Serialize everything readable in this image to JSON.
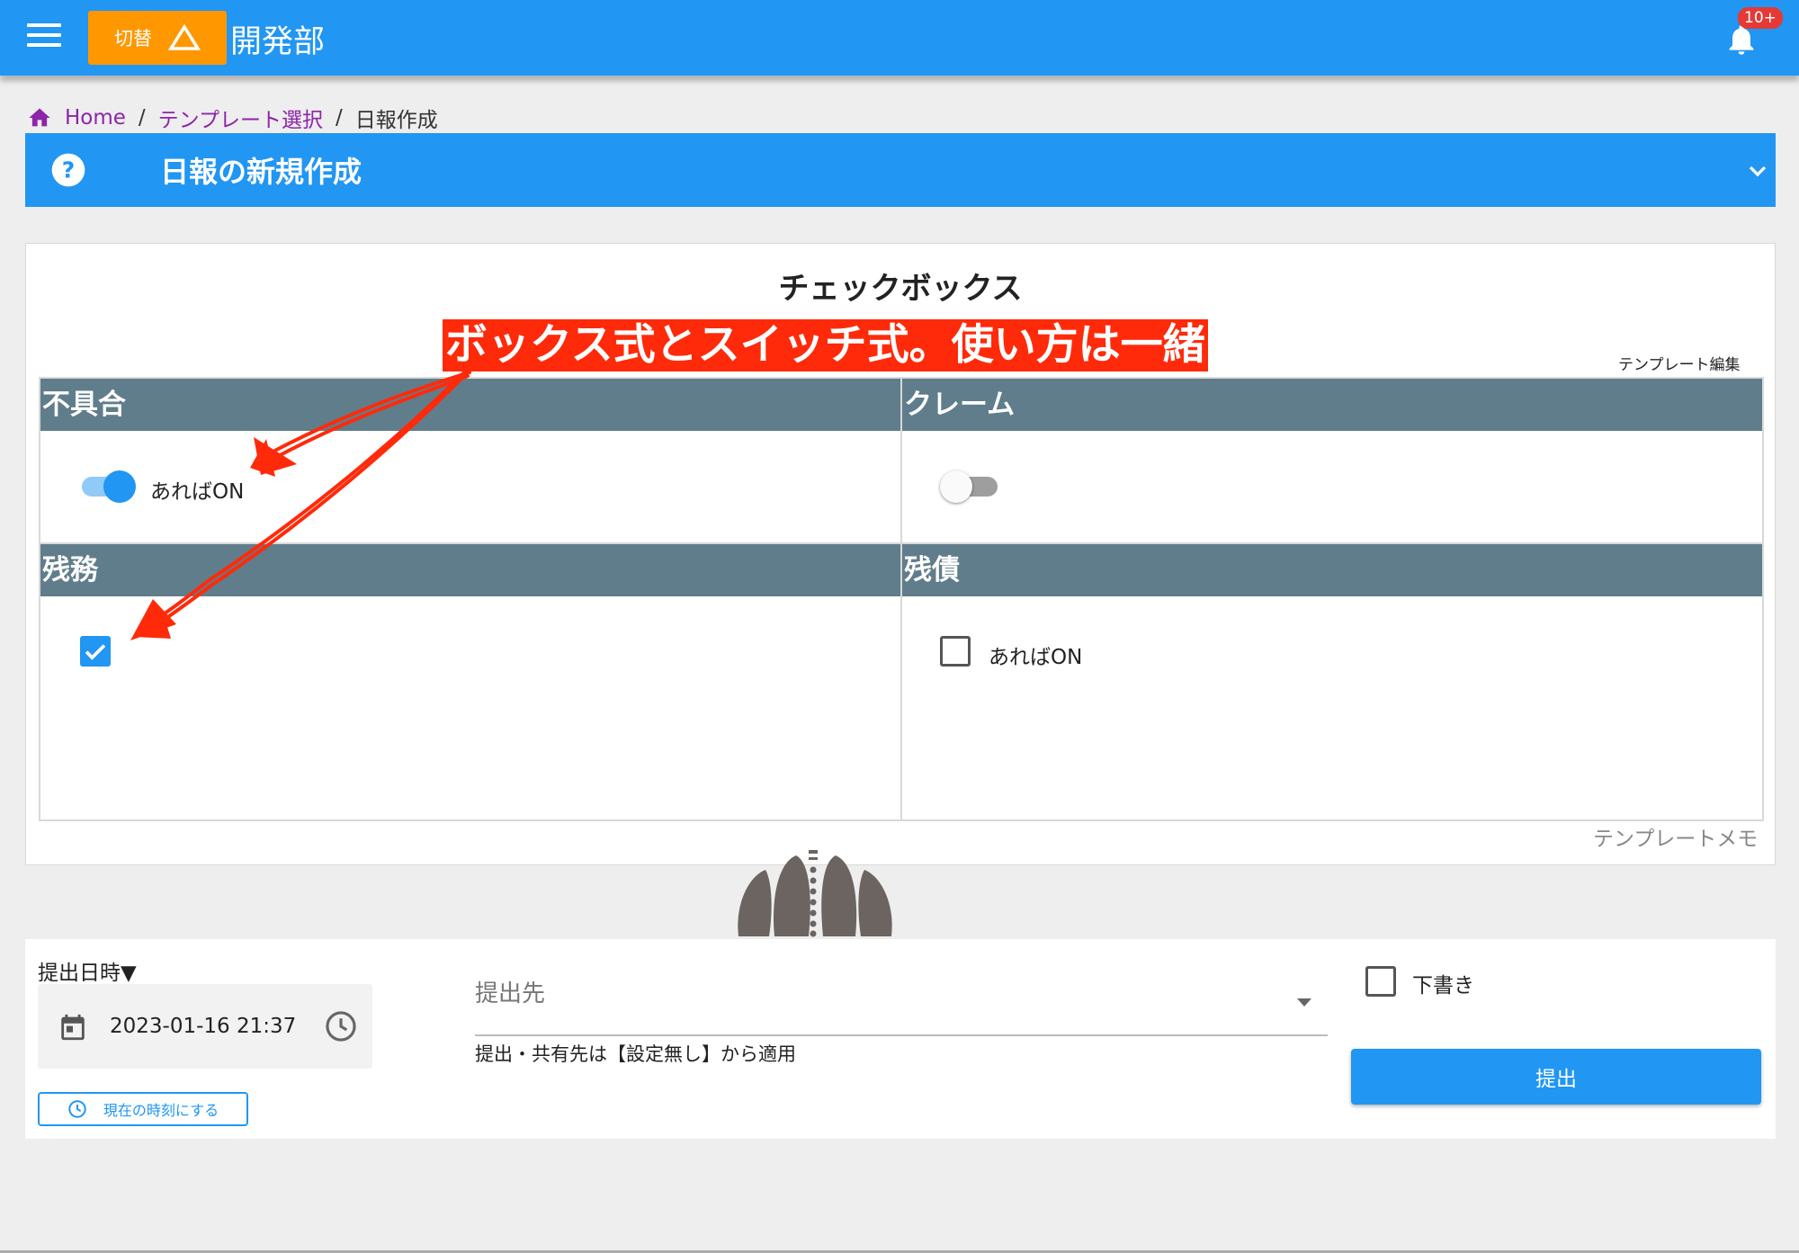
{
  "header": {
    "switch_label": "切替",
    "department": "開発部",
    "notification_badge": "10+",
    "color": "#2196f3",
    "switch_color": "#ff9800"
  },
  "breadcrumb": {
    "items": [
      "Home",
      "テンプレート選択",
      "日報作成"
    ]
  },
  "panel": {
    "title": "日報の新規作成"
  },
  "card": {
    "title": "チェックボックス",
    "annotation": "ボックス式とスイッチ式。使い方は一緒",
    "template_edit": "テンプレート編集",
    "template_memo": "テンプレートメモ",
    "fields": [
      {
        "label": "不具合",
        "type": "switch",
        "checked": true,
        "option_label": "あればON"
      },
      {
        "label": "クレーム",
        "type": "switch",
        "checked": false,
        "option_label": ""
      },
      {
        "label": "残務",
        "type": "checkbox",
        "checked": true,
        "option_label": ""
      },
      {
        "label": "残債",
        "type": "checkbox",
        "checked": false,
        "option_label": "あればON"
      }
    ]
  },
  "form": {
    "date_label": "提出日時▼",
    "date_value": "2023-01-16 21:37",
    "now_button": "現在の時刻にする",
    "destination_placeholder": "提出先",
    "destination_hint": "提出・共有先は【設定無し】から適用",
    "draft_label": "下書き",
    "draft_checked": false,
    "submit_label": "提出"
  },
  "colors": {
    "accent": "#2196f3",
    "field_header": "#607d8b",
    "annotation": "#ff2a0a",
    "breadcrumb_link": "#8e24aa"
  }
}
